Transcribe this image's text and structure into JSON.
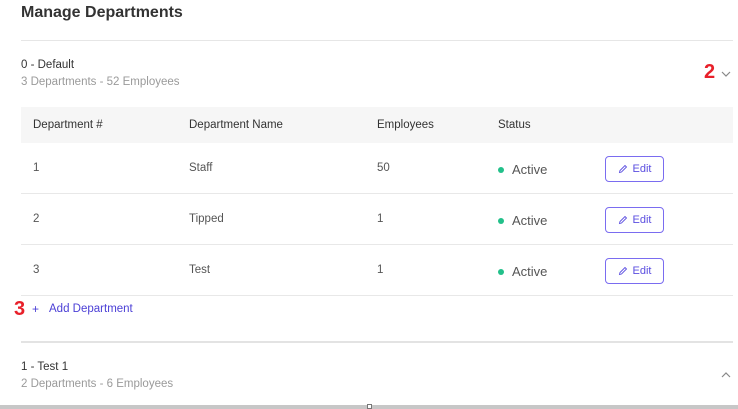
{
  "page": {
    "title": "Manage Departments"
  },
  "groups": [
    {
      "name": "0 - Default",
      "summary": "3 Departments - 52 Employees"
    },
    {
      "name": "1 - Test 1",
      "summary": "2 Departments - 6 Employees"
    }
  ],
  "annotations": {
    "a2": "2",
    "a3": "3"
  },
  "table": {
    "headers": [
      "Department #",
      "Department Name",
      "Employees",
      "Status"
    ],
    "rows": [
      {
        "number": "1",
        "name": "Staff",
        "employees": "50",
        "status": "Active",
        "action": "Edit"
      },
      {
        "number": "2",
        "name": "Tipped",
        "employees": "1",
        "status": "Active",
        "action": "Edit"
      },
      {
        "number": "3",
        "name": "Test",
        "employees": "1",
        "status": "Active",
        "action": "Edit"
      }
    ]
  },
  "add_department": {
    "label": "Add Department"
  },
  "colors": {
    "accent": "#5b4ee0",
    "status_active": "#22c08a",
    "annotation": "#e8202a"
  },
  "icons": {
    "expand": "chevron-down-icon",
    "collapse": "chevron-up-icon",
    "edit": "pencil-icon",
    "add": "plus-icon"
  }
}
